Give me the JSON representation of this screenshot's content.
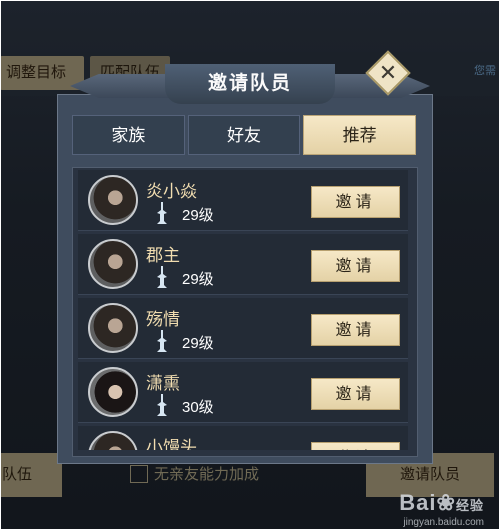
{
  "background": {
    "adjust_button_label": "调整目标",
    "second_button_label": "匹配队伍",
    "right_text": "您需",
    "team_button_label": "队伍",
    "no_affinity_text": "无亲友能力加成",
    "invite_team_button_label": "邀请队员"
  },
  "dialog": {
    "title": "邀请队员",
    "close_symbol": "✕",
    "tabs": [
      {
        "label": "家族",
        "active": false
      },
      {
        "label": "好友",
        "active": false
      },
      {
        "label": "推荐",
        "active": true
      }
    ],
    "invite_label": "邀请",
    "members": [
      {
        "name": "炎小焱",
        "level": "29级",
        "avatar": "male-long-hair"
      },
      {
        "name": "郡主",
        "level": "29级",
        "avatar": "male-long-hair"
      },
      {
        "name": "殇情",
        "level": "29级",
        "avatar": "male-long-hair"
      },
      {
        "name": "潇熏",
        "level": "30级",
        "avatar": "female-black-hair"
      },
      {
        "name": "小馒头",
        "level": "",
        "avatar": "male-long-hair"
      }
    ]
  },
  "watermark": {
    "brand": "Bai",
    "paw": "❀",
    "suffix": "经验",
    "url": "jingyan.baidu.com"
  },
  "colors": {
    "accent_gold": "#f1ddb0",
    "button_gold": "#e9d8ae",
    "panel": "#3f4c5e"
  }
}
